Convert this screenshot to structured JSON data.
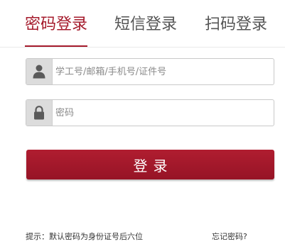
{
  "tabs": [
    {
      "label": "密码登录",
      "active": true
    },
    {
      "label": "短信登录",
      "active": false
    },
    {
      "label": "扫码登录",
      "active": false
    }
  ],
  "form": {
    "username": {
      "placeholder": "学工号/邮箱/手机号/证件号",
      "value": "",
      "icon": "user-icon"
    },
    "password": {
      "placeholder": "密码",
      "value": "",
      "icon": "lock-icon"
    },
    "submit_label": "登录"
  },
  "footer": {
    "hint": "提示：默认密码为身份证号后六位",
    "forgot_label": "忘记密码?"
  },
  "colors": {
    "accent": "#a51b2c",
    "icon_bg": "#dcdcdc",
    "icon_fg": "#5a5a5a"
  }
}
